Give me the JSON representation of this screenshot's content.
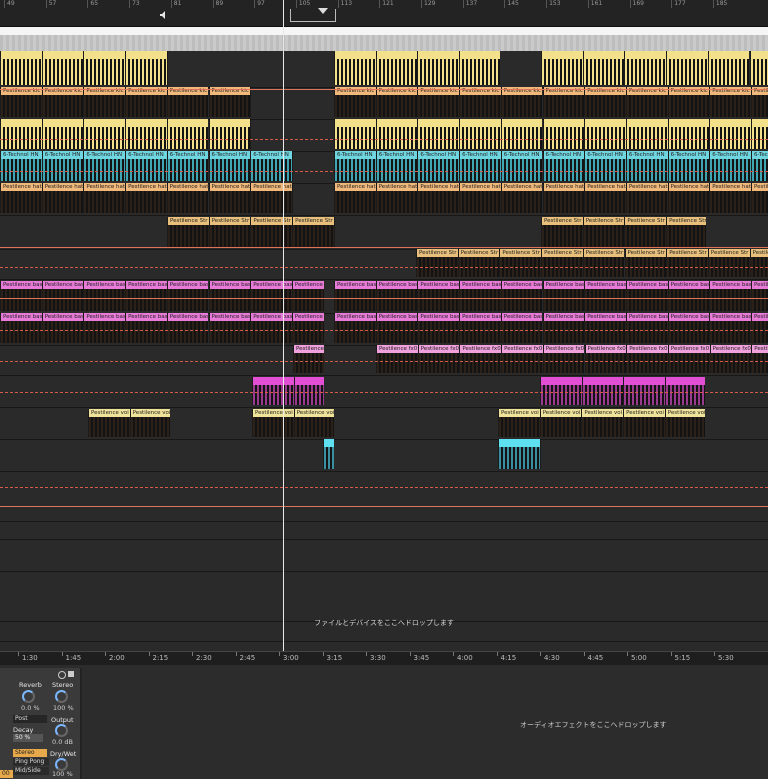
{
  "ruler": {
    "bars": [
      "49",
      "57",
      "65",
      "73",
      "81",
      "89",
      "97",
      "105",
      "113",
      "121",
      "129",
      "137",
      "145",
      "153",
      "161",
      "169",
      "177",
      "185"
    ]
  },
  "clip_names": {
    "kick": "Pestilence kic",
    "techno": "6-Technol HN",
    "hat": "Pestilence hat",
    "strings": "Pestilence Str",
    "bass": "Pestilence bas",
    "fx": "Pestilence fx0",
    "vox": "Pestilence voi",
    "blank": ""
  },
  "drop_hint_audio": "ファイルとデバイスをここへドロップします",
  "drop_hint_effect": "オーディオエフェクトをここへドロップします",
  "timeline": {
    "labels": [
      "1:30",
      "1:45",
      "2:00",
      "2:15",
      "2:30",
      "2:45",
      "3:00",
      "3:15",
      "3:30",
      "3:45",
      "4:00",
      "4:15",
      "4:30",
      "4:45",
      "5:00",
      "5:15",
      "5:30"
    ]
  },
  "device": {
    "reverb_label": "Reverb",
    "reverb_value": "0.0 %",
    "stereo_label": "Stereo",
    "stereo_value": "100 %",
    "post_label": "Post",
    "output_label": "Output",
    "output_value": "0.0 dB",
    "decay_label": "Decay",
    "decay_value": "50 %",
    "mode_stereo": "Stereo",
    "mode_pingpong": "Ping Pong",
    "mode_midside": "Mid/Side",
    "drywet_label": "Dry/Wet",
    "drywet_value": "100 %",
    "cut_value": "00"
  },
  "colors": {
    "kick": "#f0b87a",
    "yellow": "#f2e08a",
    "techno": "#6fd6e0",
    "strings": "#e8c07c",
    "bass": "#e87ad8",
    "fx": "#f0a0dc",
    "vox": "#efe39a",
    "cyan": "#5ee0f0",
    "automation": "#e0745a"
  }
}
